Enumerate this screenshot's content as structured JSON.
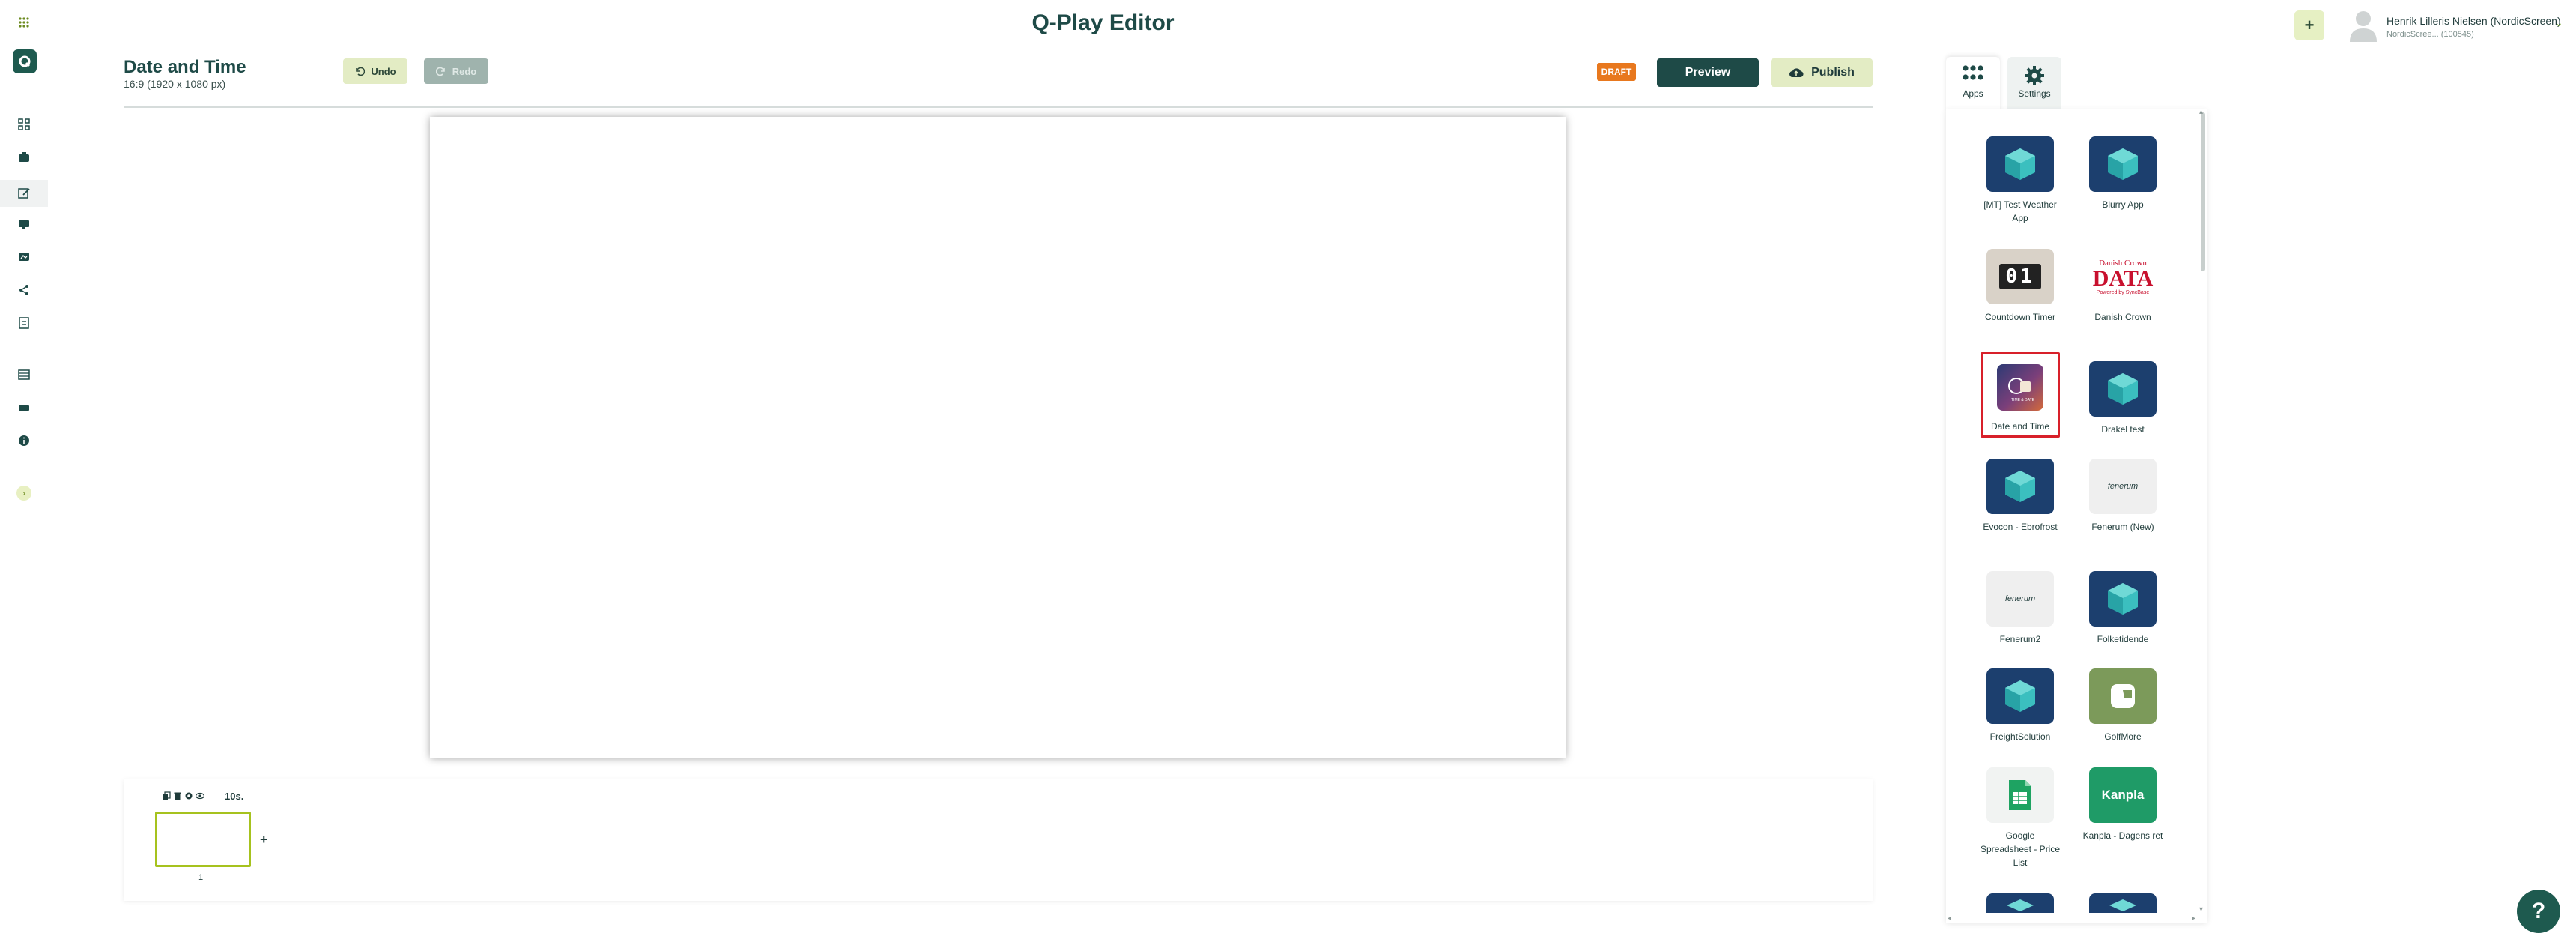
{
  "header": {
    "title": "Q-Play Editor",
    "user_name": "Henrik Lilleris Nielsen (NordicScreen)",
    "user_sub": "NordicScree... (100545)"
  },
  "page": {
    "title": "Date and Time",
    "subtitle": "16:9 (1920 x 1080 px)",
    "undo_label": "Undo",
    "redo_label": "Redo",
    "draft_badge": "DRAFT",
    "preview_label": "Preview",
    "publish_label": "Publish"
  },
  "timeline": {
    "duration": "10s.",
    "add_label": "+",
    "slide_number": "1"
  },
  "panel": {
    "tabs": [
      {
        "label": "Apps"
      },
      {
        "label": "Settings"
      }
    ],
    "apps": [
      {
        "label": "[MT] Test Weather App",
        "icon": "cube-icon"
      },
      {
        "label": "Blurry App",
        "icon": "cube-icon"
      },
      {
        "label": "Countdown Timer",
        "icon": "countdown-icon"
      },
      {
        "label": "Danish Crown",
        "icon": "danish-crown-logo"
      },
      {
        "label": "Date and Time",
        "icon": "date-time-icon"
      },
      {
        "label": "Drakel test",
        "icon": "cube-icon"
      },
      {
        "label": "Evocon - Ebrofrost",
        "icon": "cube-icon"
      },
      {
        "label": "Fenerum (New)",
        "icon": "fenerum-logo"
      },
      {
        "label": "Fenerum2",
        "icon": "fenerum-logo"
      },
      {
        "label": "Folketidende",
        "icon": "cube-icon"
      },
      {
        "label": "FreightSolution",
        "icon": "cube-icon"
      },
      {
        "label": "GolfMore",
        "icon": "golfmore-logo"
      },
      {
        "label": "Google Spreadsheet - Price List",
        "icon": "sheets-icon"
      },
      {
        "label": "Kanpla - Dagens ret",
        "icon": "kanpla-logo"
      }
    ],
    "tile_texts": {
      "countdown": "01",
      "danish_brand": "Danish Crown",
      "danish_data": "DATA",
      "danish_powered": "Powered by SyncBase",
      "fenerum": "fenerum",
      "kanpla": "Kanpla",
      "datetime_caption": "TIME & DATE"
    }
  },
  "help_label": "?",
  "colors": {
    "brand_dark": "#1e4a47",
    "accent_lime": "#e3ecc4",
    "draft_orange": "#e8781e",
    "highlight_red": "#d8202a"
  }
}
